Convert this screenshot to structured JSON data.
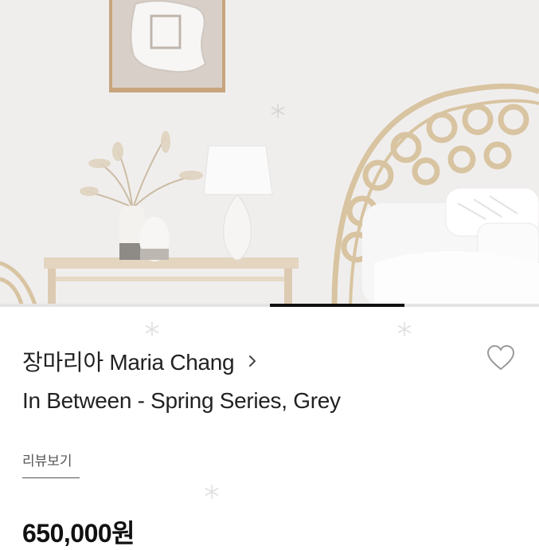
{
  "carousel": {
    "current_slide_fraction_start": 0.5,
    "current_slide_fraction_end": 0.75
  },
  "product": {
    "brand": "장마리아 Maria Chang",
    "title": "In Between - Spring Series, Grey",
    "reviews_link": "리뷰보기",
    "price": "650,000원"
  },
  "icons": {
    "chevron": "chevron-right-icon",
    "wishlist": "heart-outline-icon",
    "decoration": "snowflake-icon"
  },
  "colors": {
    "text": "#222222",
    "progress": "#111111",
    "heart_outline": "#9a9a9a"
  }
}
